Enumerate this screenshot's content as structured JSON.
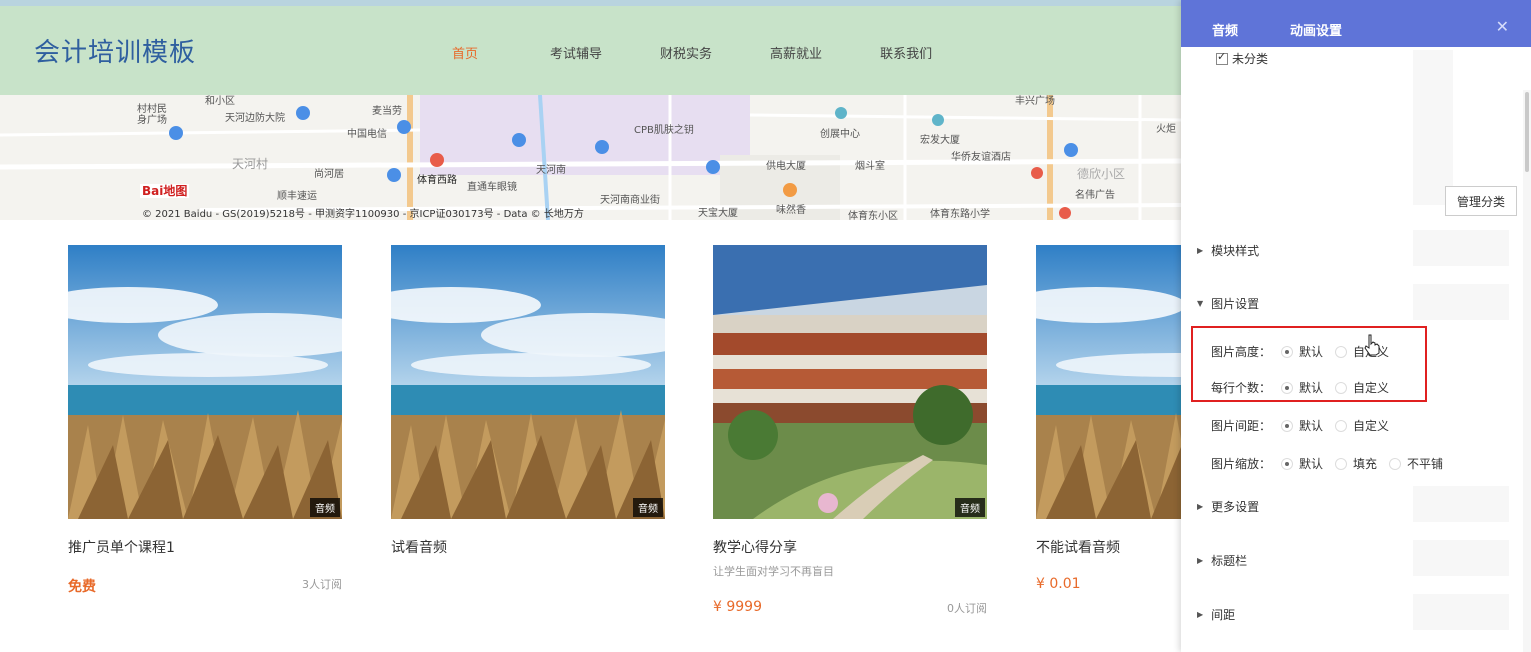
{
  "header": {
    "logo": "会计培训模板",
    "nav": [
      {
        "label": "首页",
        "active": true
      },
      {
        "label": "考试辅导",
        "active": false
      },
      {
        "label": "财税实务",
        "active": false
      },
      {
        "label": "高薪就业",
        "active": false
      },
      {
        "label": "联系我们",
        "active": false
      }
    ]
  },
  "map": {
    "labels": [
      "和小区",
      "麦当劳",
      "村村民",
      "身广场",
      "天河边防大院",
      "中国电信",
      "CPB肌肤之钥",
      "创展中心",
      "宏发大厦",
      "华侨友谊酒店",
      "天河村",
      "尚河居",
      "体育西路",
      "天河南",
      "供电大厦",
      "烟斗室",
      "德欣小区",
      "顺丰速运",
      "直通车眼镜",
      "天河南商业街",
      "天宝大厦",
      "味然香",
      "体育东小区",
      "体育东路小学",
      "名伟广告",
      "火炬",
      "丰兴广场"
    ],
    "brand": "Bai地图",
    "copyright": "© 2021 Baidu - GS(2019)5218号 - 甲测资字1100930 - 京ICP证030173号 - Data © 长地万方"
  },
  "cards": [
    {
      "title": "推广员单个课程1",
      "subtitle": "",
      "price": "免费",
      "subscribers": "3人订阅",
      "tag": "音频",
      "image": "sea-grass"
    },
    {
      "title": "试看音频",
      "subtitle": "",
      "price": "",
      "subscribers": "",
      "tag": "音频",
      "image": "sea-grass"
    },
    {
      "title": "教学心得分享",
      "subtitle": "让学生面对学习不再盲目",
      "price": "¥ 9999",
      "subscribers": "0人订阅",
      "tag": "音频",
      "image": "atrium"
    },
    {
      "title": "不能试看音频",
      "subtitle": "",
      "price": "¥ 0.01",
      "subscribers": "",
      "tag": "",
      "image": "sea-grass"
    }
  ],
  "panel": {
    "tabs": [
      "音频",
      "动画设置"
    ],
    "close_icon": "close-icon",
    "category_checkbox": "未分类",
    "manage_button": "管理分类",
    "sections": {
      "module_style": "模块样式",
      "image_settings": "图片设置",
      "more_settings": "更多设置",
      "title_bar": "标题栏",
      "spacing": "间距"
    },
    "options": [
      {
        "label": "图片高度：",
        "choices": [
          "默认",
          "自定义"
        ],
        "selected": 0
      },
      {
        "label": "每行个数：",
        "choices": [
          "默认",
          "自定义"
        ],
        "selected": 0
      },
      {
        "label": "图片间距：",
        "choices": [
          "默认",
          "自定义"
        ],
        "selected": 0
      },
      {
        "label": "图片缩放：",
        "choices": [
          "默认",
          "填充",
          "不平铺"
        ],
        "selected": 0
      }
    ],
    "accent": "#5f74d8",
    "highlight_color": "#e02020"
  },
  "colors": {
    "header_bg": "#c8e3c9",
    "logo": "#2f5f9f",
    "price": "#e86a2a"
  }
}
